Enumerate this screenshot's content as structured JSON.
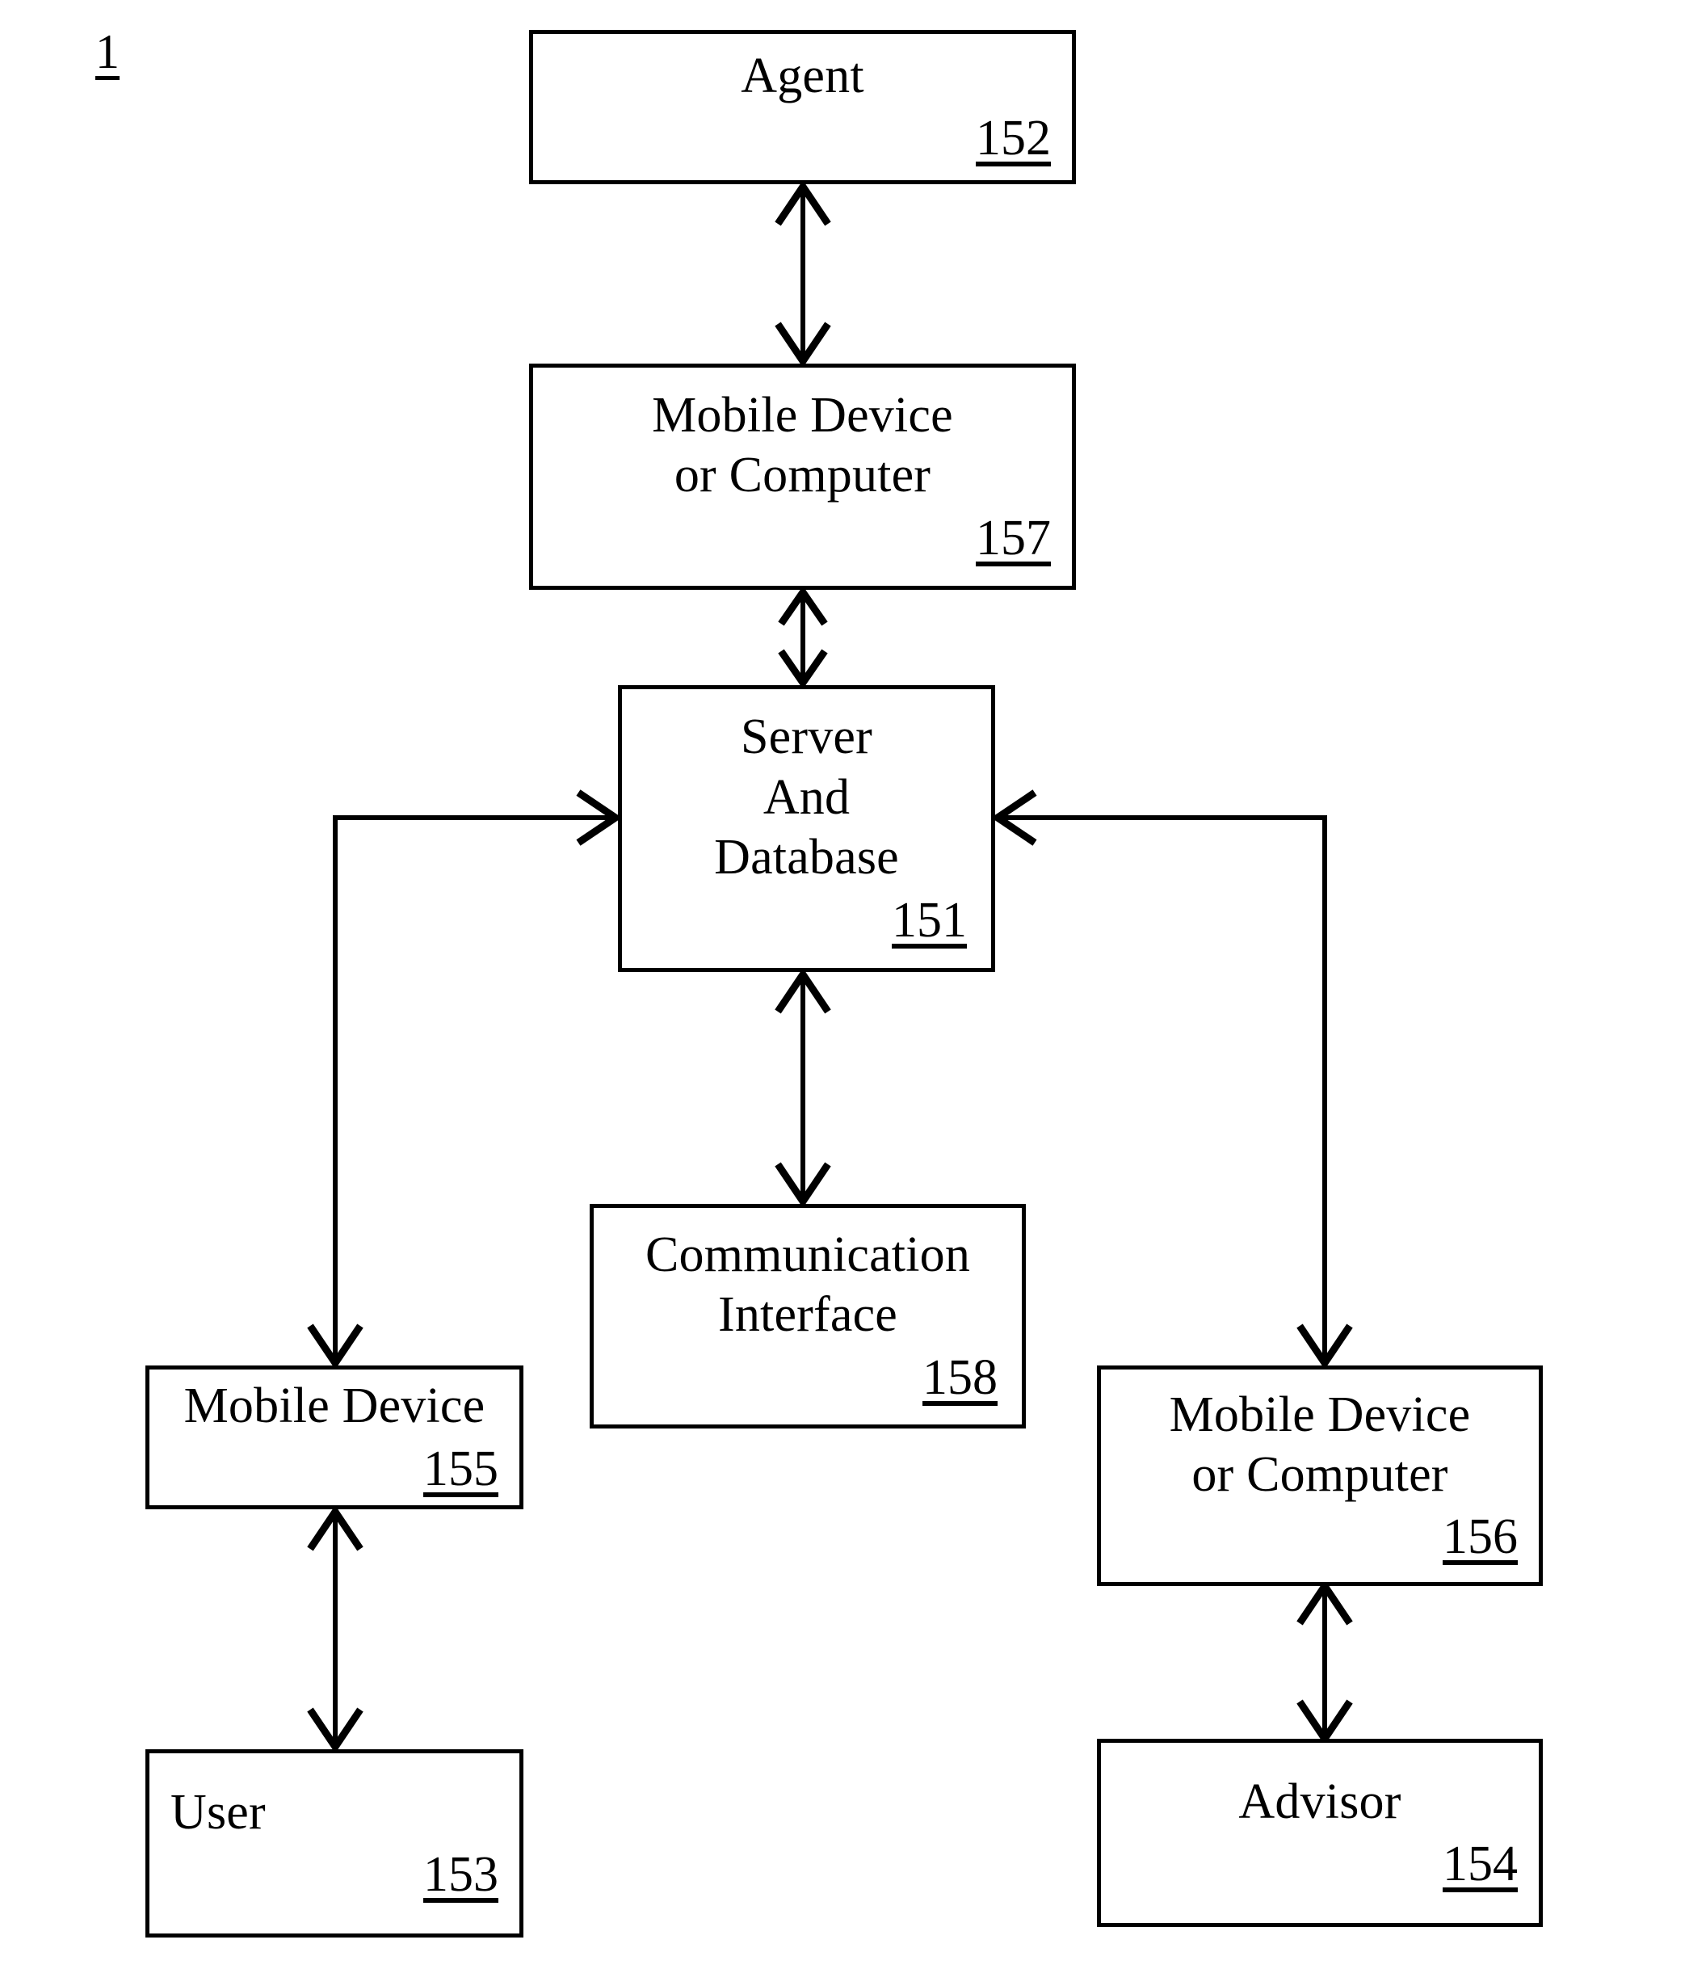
{
  "figure": {
    "number": "1",
    "title_present": false
  },
  "nodes": {
    "agent": {
      "title": "Agent",
      "ref": "152"
    },
    "mobile_device_or_computer_157": {
      "title": "Mobile Device\nor Computer",
      "ref": "157"
    },
    "server_and_database": {
      "title": "Server\nAnd\nDatabase",
      "ref": "151"
    },
    "communication_interface": {
      "title": "Communication\nInterface",
      "ref": "158"
    },
    "mobile_device_155": {
      "title": "Mobile Device",
      "ref": "155"
    },
    "user": {
      "title": "User",
      "ref": "153"
    },
    "mobile_device_or_computer_156": {
      "title": "Mobile Device\nor Computer",
      "ref": "156"
    },
    "advisor": {
      "title": "Advisor",
      "ref": "154"
    }
  },
  "connections": [
    {
      "id": "agent-to-157",
      "from": "agent",
      "to": "mobile_device_or_computer_157",
      "style": "double-arrow-vertical"
    },
    {
      "id": "157-to-151",
      "from": "mobile_device_or_computer_157",
      "to": "server_and_database",
      "style": "double-arrow-vertical"
    },
    {
      "id": "151-to-158",
      "from": "server_and_database",
      "to": "communication_interface",
      "style": "double-arrow-vertical"
    },
    {
      "id": "155-to-151",
      "from": "mobile_device_155",
      "to": "server_and_database",
      "style": "elbow-left-double-arrow"
    },
    {
      "id": "156-to-151",
      "from": "mobile_device_or_computer_156",
      "to": "server_and_database",
      "style": "elbow-right-double-arrow"
    },
    {
      "id": "153-to-155",
      "from": "user",
      "to": "mobile_device_155",
      "style": "double-arrow-vertical"
    },
    {
      "id": "154-to-156",
      "from": "advisor",
      "to": "mobile_device_or_computer_156",
      "style": "double-arrow-vertical"
    }
  ],
  "colors": {
    "ink": "#000000",
    "paper": "#ffffff"
  }
}
